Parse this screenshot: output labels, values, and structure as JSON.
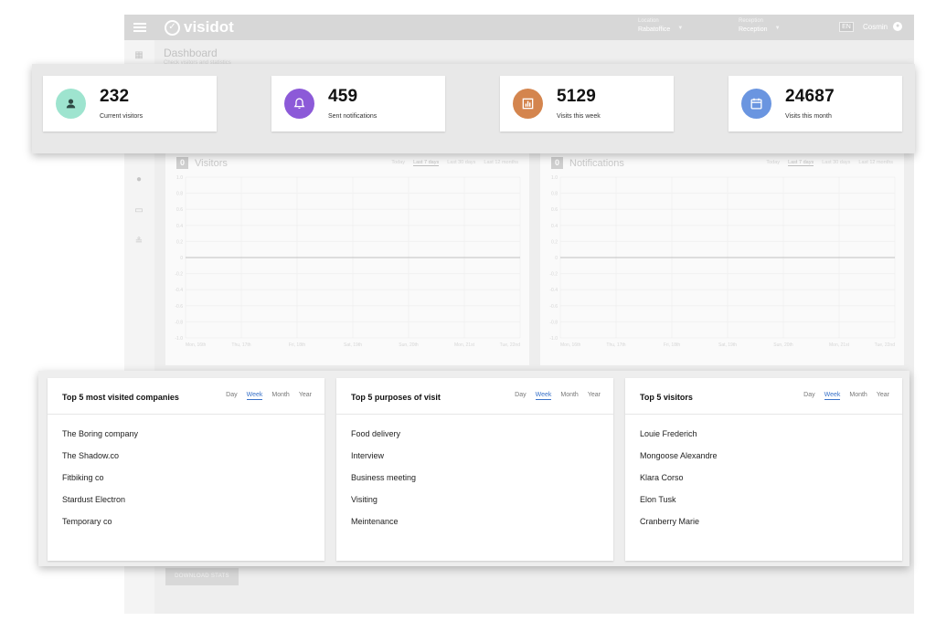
{
  "app": {
    "logo_text": "visidot",
    "location": {
      "label": "Location",
      "value": "Rabatoffice"
    },
    "reception": {
      "label": "Reception",
      "value": "Reception"
    },
    "user_name": "Cosmin",
    "page_title": "Dashboard",
    "page_subtitle": "Check visitors and statistics"
  },
  "stats": [
    {
      "value": "232",
      "label": "Current visitors",
      "color": "#9ee4cf",
      "icon": "person-icon"
    },
    {
      "value": "459",
      "label": "Sent notifications",
      "color": "#8c5ad8",
      "icon": "bell-icon"
    },
    {
      "value": "5129",
      "label": "Visits this week",
      "color": "#d4854e",
      "icon": "bar-chart-icon"
    },
    {
      "value": "24687",
      "label": "Visits this month",
      "color": "#6a95e0",
      "icon": "calendar-icon"
    }
  ],
  "charts": {
    "ranges": [
      "Today",
      "Last 7 days",
      "Last 30 days",
      "Last 12 months"
    ],
    "selected_range": "Last 7 days",
    "visitors": {
      "title": "Visitors",
      "count": "0"
    },
    "notifications": {
      "title": "Notifications",
      "count": "0"
    }
  },
  "chart_data": [
    {
      "type": "line",
      "title": "Visitors",
      "x": [
        "Mon, 16th",
        "Thu, 17th",
        "Fri, 18th",
        "Sat, 19th",
        "Sun, 20th",
        "Mon, 21st",
        "Tue, 22nd"
      ],
      "series": [
        {
          "values": [
            0,
            0,
            0,
            0,
            0,
            0,
            0
          ]
        }
      ],
      "y_ticks": [
        "1.0",
        "0.8",
        "0.6",
        "0.4",
        "0.2",
        "0",
        "-0.2",
        "-0.4",
        "-0.6",
        "-0.8",
        "-1.0"
      ],
      "ylim": [
        -1,
        1
      ],
      "grid": true
    },
    {
      "type": "line",
      "title": "Notifications",
      "x": [
        "Mon, 16th",
        "Thu, 17th",
        "Fri, 18th",
        "Sat, 19th",
        "Sun, 20th",
        "Mon, 21st",
        "Tue, 22nd"
      ],
      "series": [
        {
          "values": [
            0,
            0,
            0,
            0,
            0,
            0,
            0
          ]
        }
      ],
      "y_ticks": [
        "1.0",
        "0.8",
        "0.6",
        "0.4",
        "0.2",
        "0",
        "-0.2",
        "-0.4",
        "-0.6",
        "-0.8",
        "-1.0"
      ],
      "ylim": [
        -1,
        1
      ],
      "grid": true
    }
  ],
  "periods": [
    "Day",
    "Week",
    "Month",
    "Year"
  ],
  "active_period": "Week",
  "lists": [
    {
      "title": "Top 5 most visited companies",
      "items": [
        "The Boring company",
        "The Shadow.co",
        "Fitbiking co",
        "Stardust Electron",
        "Temporary co"
      ]
    },
    {
      "title": "Top 5 purposes of visit",
      "items": [
        "Food delivery",
        "Interview",
        "Business meeting",
        "Visiting",
        "Meintenance"
      ]
    },
    {
      "title": "Top 5 visitors",
      "items": [
        "Louie Frederich",
        "Mongoose Alexandre",
        "Klara Corso",
        "Elon Tusk",
        "Cranberry Marie"
      ]
    }
  ],
  "download_label": "DOWNLOAD STATS",
  "flag_label": "EN"
}
